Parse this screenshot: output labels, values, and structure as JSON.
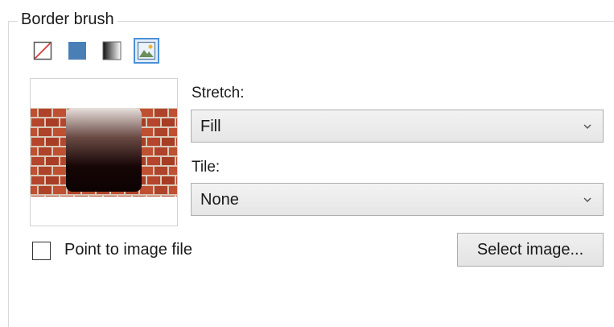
{
  "group": {
    "title": "Border brush"
  },
  "brush_types": [
    {
      "name": "no-brush",
      "icon": "no-brush-icon",
      "selected": false
    },
    {
      "name": "solid-color-brush",
      "icon": "solid-color-brush-icon",
      "selected": false
    },
    {
      "name": "gradient-brush",
      "icon": "gradient-brush-icon",
      "selected": false
    },
    {
      "name": "image-brush",
      "icon": "image-brush-icon",
      "selected": true
    }
  ],
  "stretch": {
    "label": "Stretch:",
    "value": "Fill"
  },
  "tile": {
    "label": "Tile:",
    "value": "None"
  },
  "point_to_file": {
    "label": "Point to image file",
    "checked": false
  },
  "select_image_button": {
    "label": "Select image..."
  },
  "colors": {
    "accent": "#4a90d9",
    "solid_swatch": "#4a7fb5",
    "brick": "#b5452c",
    "mortar": "#d9c9b8"
  }
}
